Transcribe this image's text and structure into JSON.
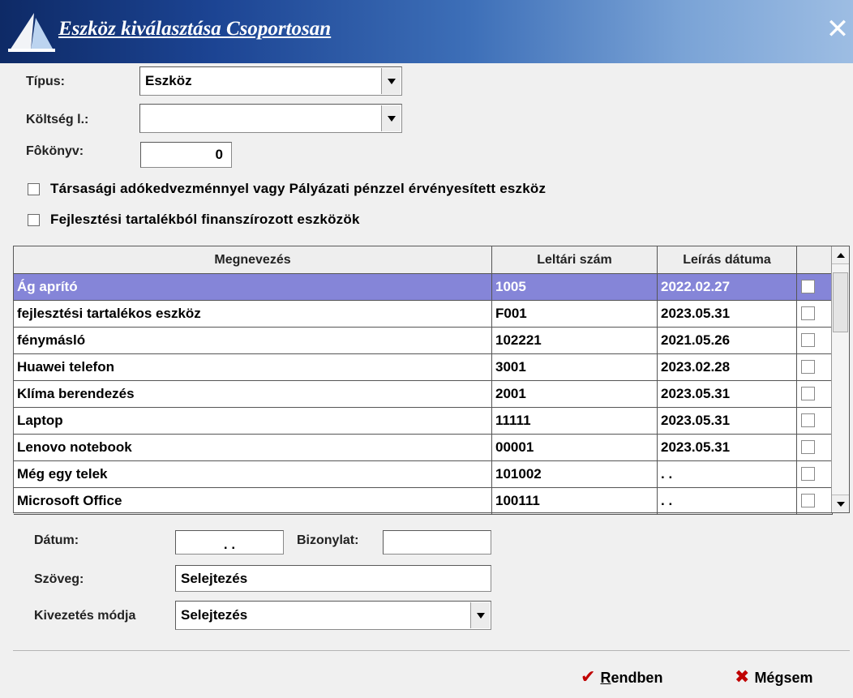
{
  "window": {
    "title": "Eszköz kiválasztása Csoportosan",
    "close_glyph": "✕"
  },
  "form": {
    "tipus_label": "Típus:",
    "tipus_value": "Eszköz",
    "koltseg_label": "Költség l.:",
    "koltseg_value": "",
    "fokonyv_label": "Fôkönyv:",
    "fokonyv_value": "0",
    "check1_label": "Társasági adókedvezménnyel vagy Pályázati pénzzel érvényesített eszköz",
    "check2_label": "Fejlesztési tartalékból finanszírozott eszközök"
  },
  "grid": {
    "headers": [
      "Megnevezés",
      "Leltári szám",
      "Leírás dátuma",
      ""
    ],
    "rows": [
      {
        "name": "Ág aprító",
        "number": "1005",
        "date": "2022.02.27",
        "selected": true
      },
      {
        "name": "fejlesztési tartalékos eszköz",
        "number": "F001",
        "date": "2023.05.31"
      },
      {
        "name": "fénymásló",
        "number": "102221",
        "date": "2021.05.26"
      },
      {
        "name": "Huawei telefon",
        "number": "3001",
        "date": "2023.02.28"
      },
      {
        "name": "Klíma berendezés",
        "number": "2001",
        "date": "2023.05.31"
      },
      {
        "name": "Laptop",
        "number": "11111",
        "date": "2023.05.31"
      },
      {
        "name": "Lenovo notebook",
        "number": "00001",
        "date": "2023.05.31"
      },
      {
        "name": "Még egy telek",
        "number": "101002",
        "date": ". ."
      },
      {
        "name": "Microsoft Office",
        "number": "100111",
        "date": ". ."
      }
    ]
  },
  "details": {
    "datum_label": "Dátum:",
    "datum_value": ". .",
    "bizonylat_label": "Bizonylat:",
    "bizonylat_value": "",
    "szoveg_label": "Szöveg:",
    "szoveg_value": "Selejtezés",
    "kivezetes_label": "Kivezetés módja",
    "kivezetes_value": "Selejtezés"
  },
  "buttons": {
    "ok_icon": "✔",
    "ok_first": "R",
    "ok_rest": "endben",
    "cancel_icon": "✖",
    "cancel_label": "Mégsem"
  }
}
